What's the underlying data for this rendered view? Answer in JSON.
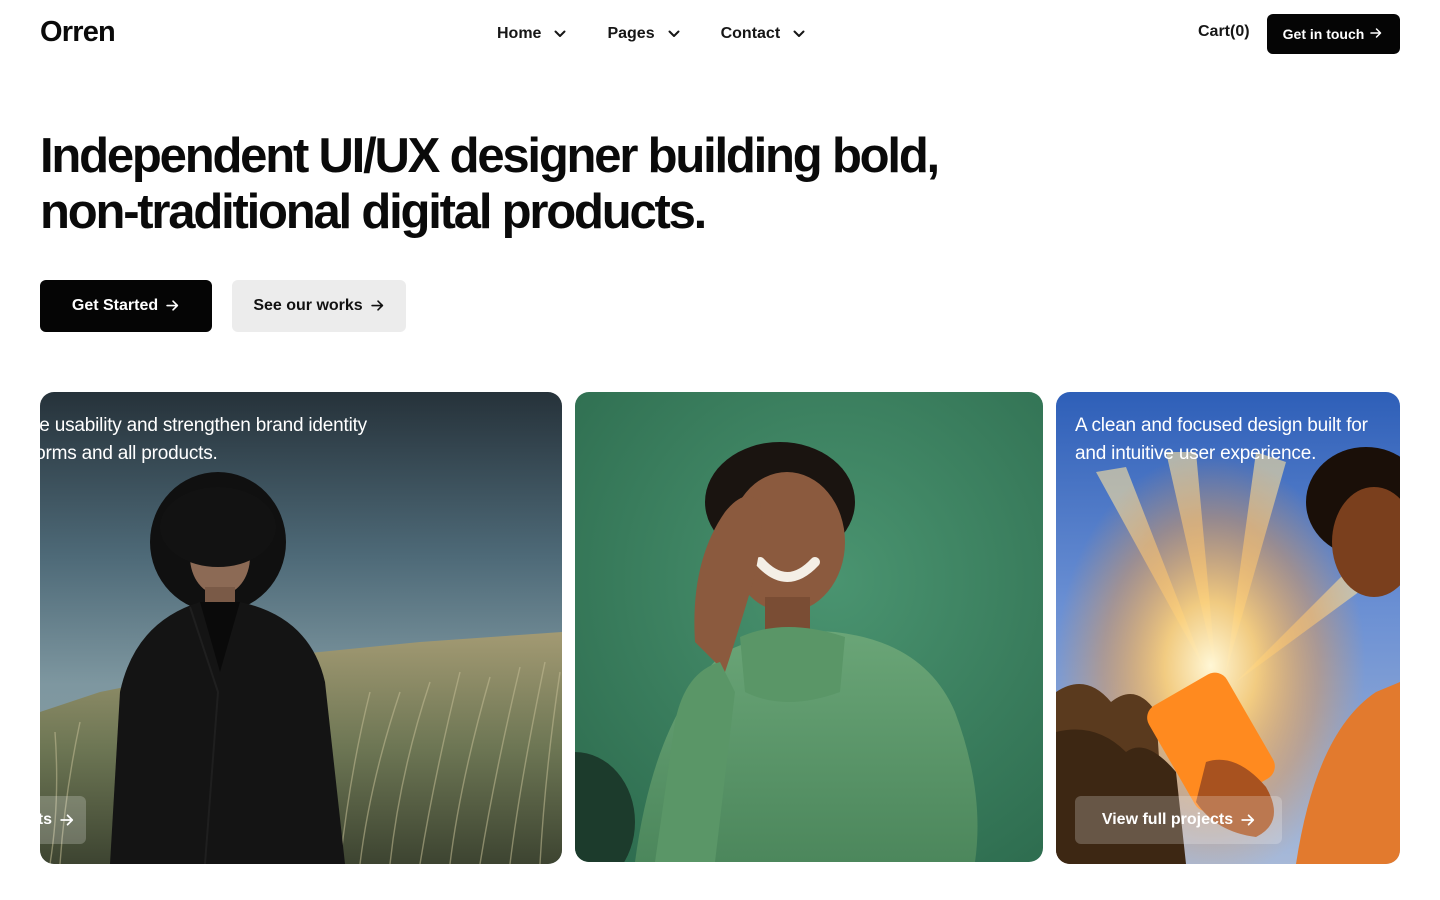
{
  "header": {
    "logo": "Orren",
    "nav": [
      {
        "label": "Home"
      },
      {
        "label": "Pages"
      },
      {
        "label": "Contact"
      }
    ],
    "cart_label": "Cart(0)",
    "cta_label": "Get in touch"
  },
  "hero": {
    "title_line1": "Independent UI/UX designer building bold,",
    "title_line2": "non-traditional digital products.",
    "primary_button": "Get Started",
    "secondary_button": "See our works"
  },
  "cards": [
    {
      "caption_line1": "ce usability and strengthen brand identity",
      "caption_line2": "forms and all products.",
      "button_label": "View full projects"
    },
    {
      "caption_line1": "",
      "caption_line2": ""
    },
    {
      "caption_line1": "A clean and focused design built for",
      "caption_line2": "and intuitive user experience.",
      "button_label": "View full projects"
    }
  ],
  "icons": {
    "nav_dropdown": "chevron-down-icon",
    "button_arrow": "arrow-right-icon"
  },
  "colors": {
    "primary": "#050505",
    "secondary_button_bg": "#ececec",
    "text": "#0a0a0a"
  }
}
